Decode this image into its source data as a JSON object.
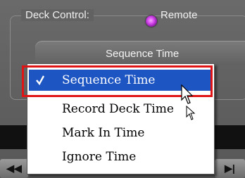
{
  "deck_control": {
    "label": "Deck Control:",
    "radio_label": "Remote"
  },
  "dropdown": {
    "current_value": "Sequence Time"
  },
  "transport": {
    "rewind_label": "◀◀",
    "play_label": "▶|"
  },
  "menu": {
    "items": [
      {
        "label": "Sequence Time",
        "checked": true
      },
      {
        "label": "Record Deck Time"
      },
      {
        "label": "Mark In Time"
      },
      {
        "label": "Ignore Time"
      }
    ]
  },
  "colors": {
    "selection": "#1d55c2",
    "annotation_box": "#e01414",
    "radio": "#d84cf0"
  }
}
